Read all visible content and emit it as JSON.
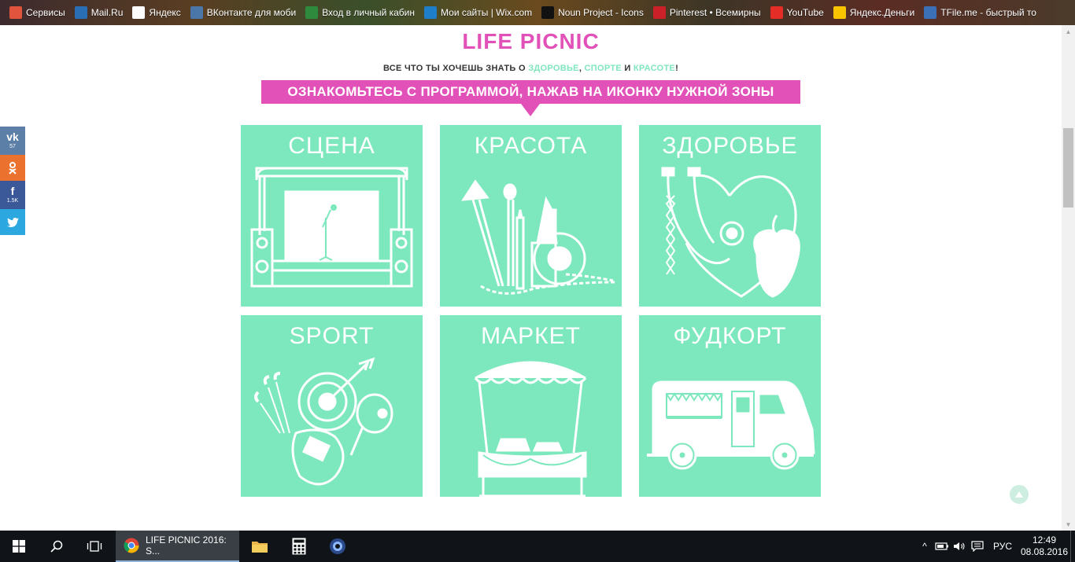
{
  "bookmarks": [
    {
      "label": "Сервисы",
      "icon": "apps-grid-icon",
      "color": "#e0533d"
    },
    {
      "label": "Mail.Ru",
      "icon": "mailru-icon",
      "color": "#2a6fb6"
    },
    {
      "label": "Яндекс",
      "icon": "yandex-icon",
      "color": "#ffffff"
    },
    {
      "label": "ВКонтакте для моби",
      "icon": "vk-icon",
      "color": "#4a76a8"
    },
    {
      "label": "Вход в личный кабин",
      "icon": "green-leaf-icon",
      "color": "#2e8b3d"
    },
    {
      "label": "Мои сайты | Wix.com",
      "icon": "wix-icon",
      "color": "#1e7ec8"
    },
    {
      "label": "Noun Project - Icons",
      "icon": "noun-project-icon",
      "color": "#111111"
    },
    {
      "label": "Pinterest • Всемирны",
      "icon": "pinterest-icon",
      "color": "#cb2027"
    },
    {
      "label": "YouTube",
      "icon": "youtube-icon",
      "color": "#e52d27"
    },
    {
      "label": "Яндекс.Деньги",
      "icon": "yandex-money-icon",
      "color": "#f8c400"
    },
    {
      "label": "TFile.me - быстрый то",
      "icon": "tfile-icon",
      "color": "#3b6fb6"
    }
  ],
  "page": {
    "title": "LIFE PICNIC",
    "tagline_prefix": "ВСЕ ЧТО ТЫ ХОЧЕШЬ ЗНАТЬ О ",
    "tagline_health": "ЗДОРОВЬЕ",
    "tagline_sep1": ", ",
    "tagline_sport": "СПОРТЕ",
    "tagline_and": " И ",
    "tagline_beauty": "КРАСОТЕ",
    "tagline_suffix": "!",
    "banner": "ОЗНАКОМЬТЕСЬ С ПРОГРАММОЙ, НАЖАВ НА ИКОНКУ НУЖНОЙ ЗОНЫ",
    "zones": [
      {
        "label": "СЦЕНА",
        "icon": "stage-icon"
      },
      {
        "label": "КРАСОТА",
        "icon": "makeup-icon"
      },
      {
        "label": "ЗДОРОВЬЕ",
        "icon": "health-icon"
      },
      {
        "label": "SPORT",
        "icon": "sport-icon"
      },
      {
        "label": "МАРКЕТ",
        "icon": "market-stall-icon"
      },
      {
        "label": "ФУДКОРТ",
        "icon": "food-truck-icon"
      }
    ]
  },
  "social": [
    {
      "icon": "vk-icon",
      "glyph": "vk",
      "count": "57",
      "color": "#5b7fa6"
    },
    {
      "icon": "odnoklassniki-icon",
      "glyph": "ok",
      "count": "",
      "color": "#eb722e"
    },
    {
      "icon": "facebook-icon",
      "glyph": "f",
      "count": "1.5K",
      "color": "#3b5998"
    },
    {
      "icon": "twitter-icon",
      "glyph": "t",
      "count": "",
      "color": "#2ca7e0"
    }
  ],
  "taskbar": {
    "active_window": "LIFE PICNIC 2016: S...",
    "language": "РУС",
    "time": "12:49",
    "date": "08.08.2016"
  },
  "colors": {
    "accent_pink": "#e251b8",
    "zone_green": "#7de8bd"
  }
}
